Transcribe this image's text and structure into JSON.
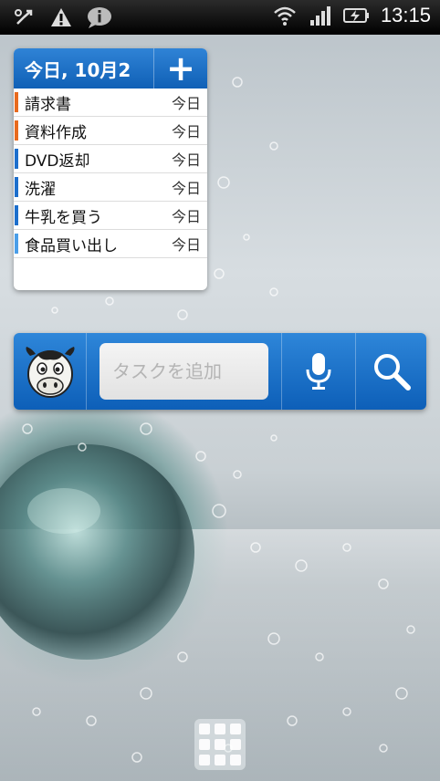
{
  "status_bar": {
    "time": "13:15",
    "left_icons": [
      "usb-debug-icon",
      "warning-icon",
      "chat-bubble-icon"
    ],
    "right_icons": [
      "wifi-icon",
      "signal-icon",
      "battery-charging-icon"
    ]
  },
  "task_widget": {
    "title": "今日, 10月2",
    "add_symbol": "+",
    "items": [
      {
        "name": "請求書",
        "date": "今日",
        "color": "#e86a1e"
      },
      {
        "name": "資料作成",
        "date": "今日",
        "color": "#e86a1e"
      },
      {
        "name": "DVD返却",
        "date": "今日",
        "color": "#1d6fcc"
      },
      {
        "name": "洗濯",
        "date": "今日",
        "color": "#1d6fcc"
      },
      {
        "name": "牛乳を買う",
        "date": "今日",
        "color": "#1d6fcc"
      },
      {
        "name": "食品買い出し",
        "date": "今日",
        "color": "#4a9ee8"
      }
    ]
  },
  "search_widget": {
    "placeholder": "タスクを追加",
    "logo_icon": "cow-logo-icon",
    "mic_icon": "microphone-icon",
    "search_icon": "search-icon"
  },
  "dock": {
    "app_drawer_icon": "app-drawer-grid-icon"
  },
  "colors": {
    "accent": "#1468c4",
    "status_bar": "#000000"
  }
}
